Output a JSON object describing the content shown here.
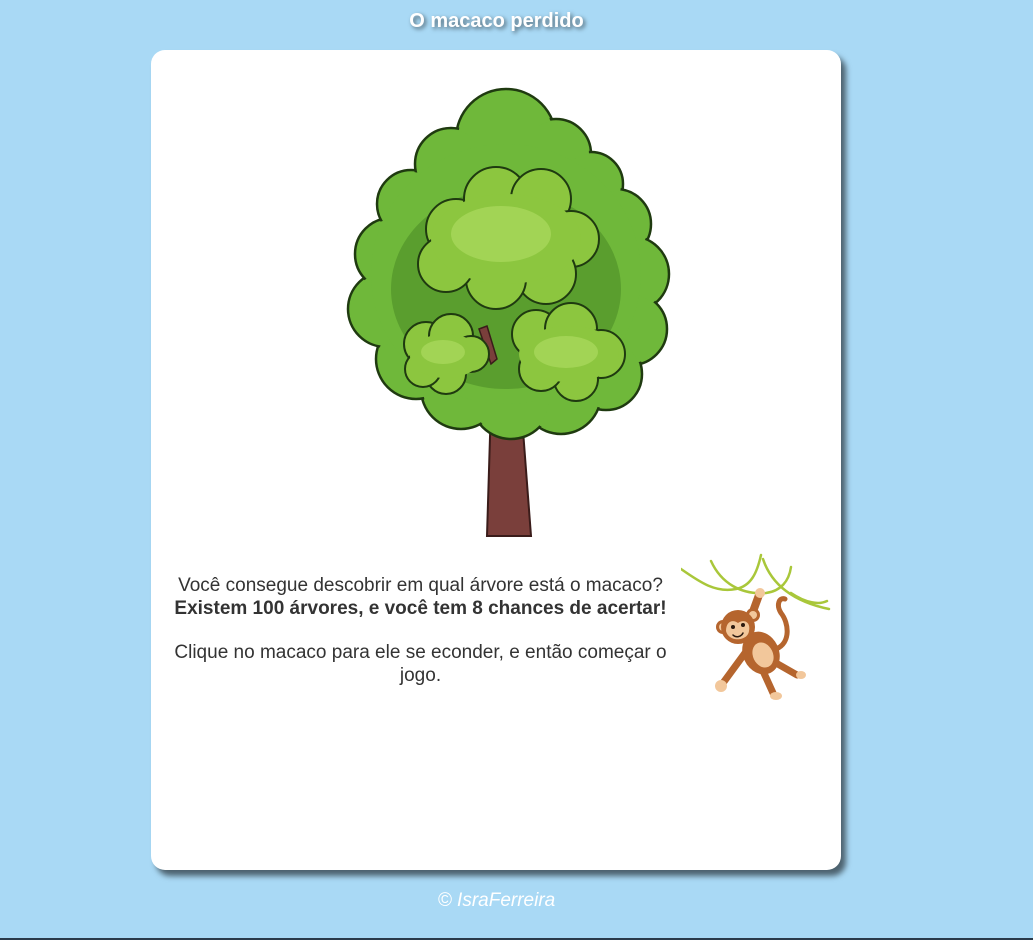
{
  "header": {
    "title": "O macaco perdido"
  },
  "game": {
    "question": "Você consegue descobrir em qual árvore está o macaco?",
    "rules": "Existem 100 árvores, e você tem 8 chances de acertar!",
    "instruction": "Clique no macaco para ele se econder, e então começar o jogo.",
    "tree_image": "tree-icon",
    "monkey_image": "monkey-icon"
  },
  "footer": {
    "credit": "© IsraFerreira"
  },
  "colors": {
    "background": "#a9d9f5",
    "card": "#ffffff",
    "text": "#333333",
    "foliage": "#6fb83a",
    "trunk": "#7a3f3b",
    "monkey": "#b5652e"
  }
}
